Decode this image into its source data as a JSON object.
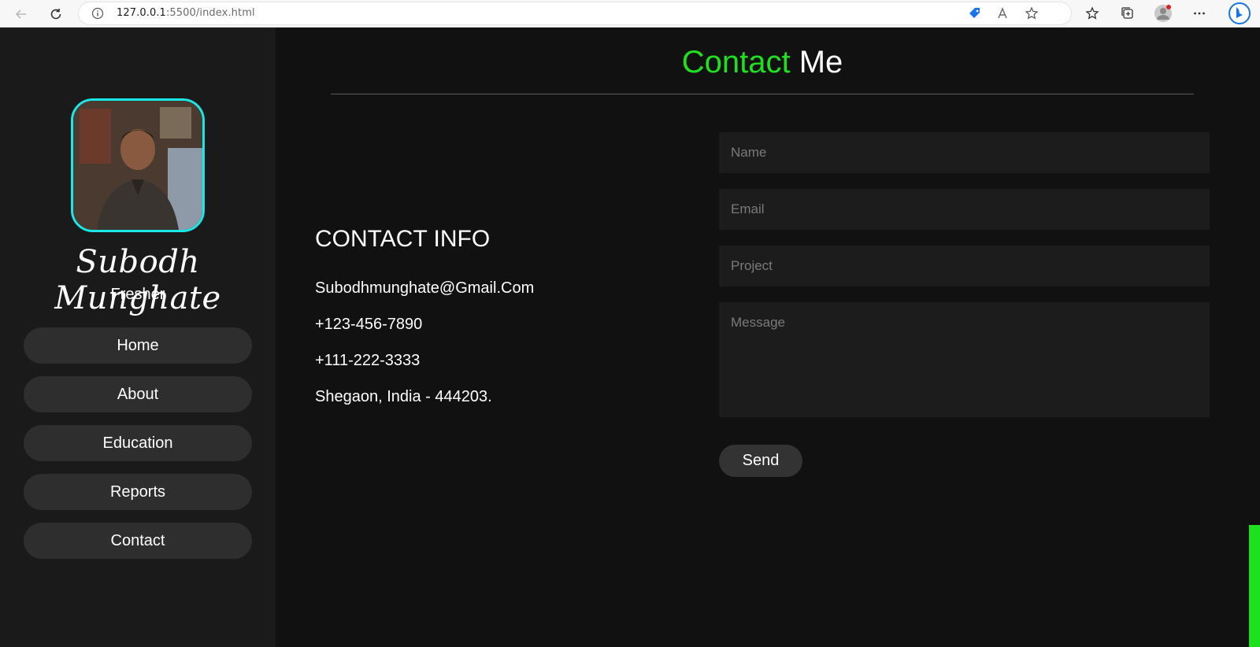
{
  "browser": {
    "url_host": "127.0.0.1",
    "url_port": ":5500",
    "url_path": "/index.html"
  },
  "sidebar": {
    "name": "Subodh Munghate",
    "role": "Fresher",
    "items": [
      {
        "label": "Home"
      },
      {
        "label": "About"
      },
      {
        "label": "Education"
      },
      {
        "label": "Reports"
      },
      {
        "label": "Contact"
      }
    ]
  },
  "main": {
    "heading_accent": "Contact",
    "heading_rest": "Me",
    "contact_info": {
      "title": "CONTACT INFO",
      "email": "Subodhmunghate@Gmail.Com",
      "phone1": "+123-456-7890",
      "phone2": "+111-222-3333",
      "address": "Shegaon, India - 444203."
    },
    "form": {
      "name_placeholder": "Name",
      "email_placeholder": "Email",
      "project_placeholder": "Project",
      "message_placeholder": "Message",
      "send_label": "Send"
    }
  },
  "colors": {
    "accent": "#1fe01f",
    "avatar_border": "#18e8e8",
    "sidebar_bg": "#1a1a1a",
    "main_bg": "#111111",
    "button_bg": "#2e2e2e"
  }
}
